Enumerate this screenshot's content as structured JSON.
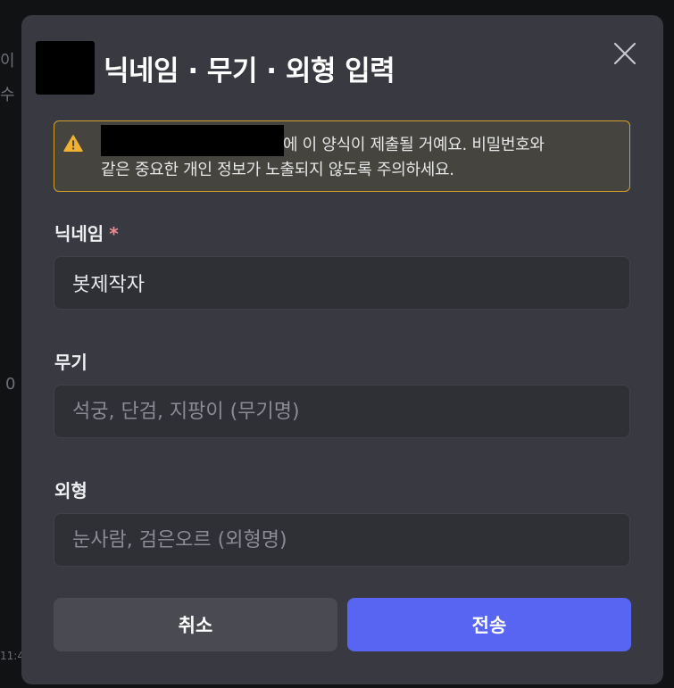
{
  "background": {
    "fragments": [
      "이",
      "수",
      "0",
      "11:4"
    ]
  },
  "modal": {
    "title": "닉네임 · 무기 · 외형 입력",
    "warning_text_line1": "에 이 양식이 제출될 거예요. 비밀번호와",
    "warning_text_line2": "같은 중요한 개인 정보가 노출되지 않도록 주의하세요.",
    "fields": [
      {
        "label": "닉네임",
        "required_mark": "*",
        "value": "봇제작자",
        "placeholder": ""
      },
      {
        "label": "무기",
        "value": "",
        "placeholder": "석궁, 단검, 지팡이 (무기명)"
      },
      {
        "label": "외형",
        "value": "",
        "placeholder": "눈사람, 검은오르 (외형명)"
      }
    ],
    "cancel_label": "취소",
    "submit_label": "전송"
  },
  "colors": {
    "modal_bg": "#393a41",
    "input_bg": "#2f3036",
    "warning_border": "#d4a02c",
    "primary": "#5865f2",
    "required": "#f38b8f"
  }
}
